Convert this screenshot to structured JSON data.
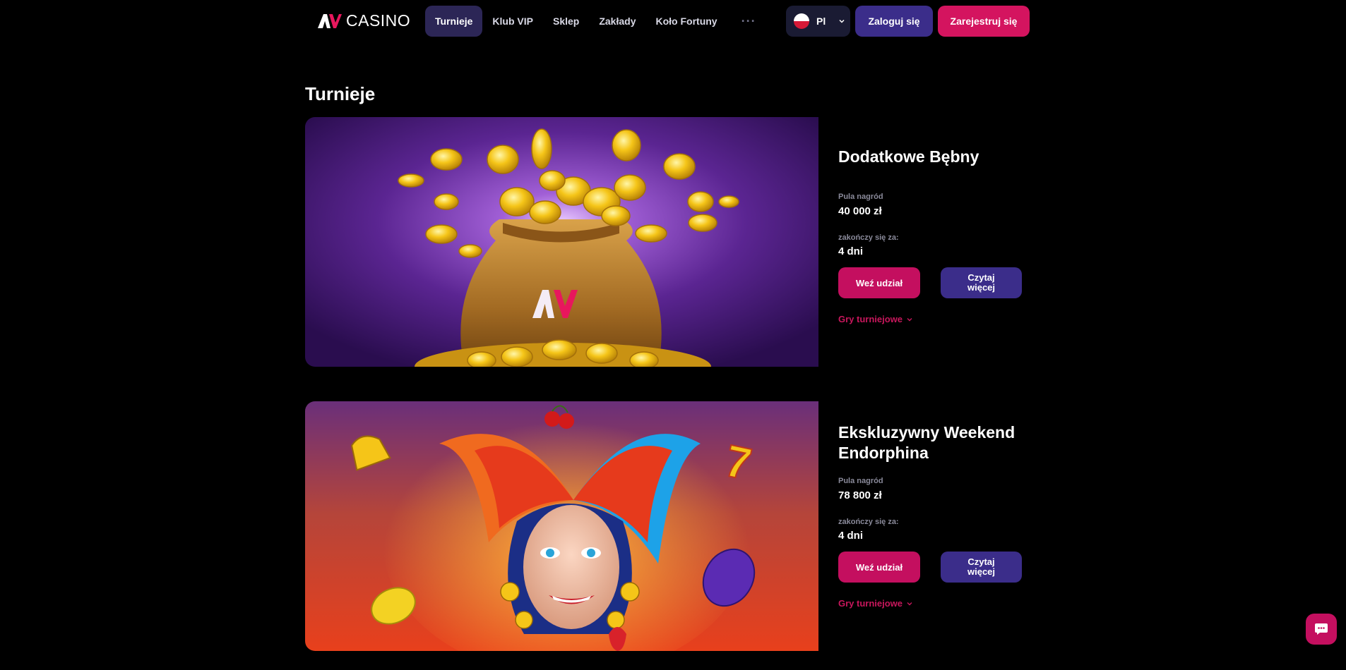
{
  "header": {
    "logo_text": "CASINO",
    "nav": [
      {
        "label": "Turnieje",
        "active": true
      },
      {
        "label": "Klub VIP"
      },
      {
        "label": "Sklep"
      },
      {
        "label": "Zakłady"
      },
      {
        "label": "Koło Fortuny"
      }
    ],
    "more_label": "···",
    "language": "Pl",
    "login_label": "Zaloguj się",
    "register_label": "Zarejestruj się"
  },
  "page": {
    "title": "Turnieje"
  },
  "tournaments": [
    {
      "title": "Dodatkowe Bębny",
      "prize_label": "Pula nagród",
      "prize_value": "40 000 zł",
      "ends_label": "zakończy się za:",
      "ends_value": "4 dni",
      "join_label": "Weź udział",
      "more_label": "Czytaj więcej",
      "games_label": "Gry turniejowe",
      "image": "gold-coin-sack"
    },
    {
      "title": "Ekskluzywny Weekend Endorphina",
      "prize_label": "Pula nagród",
      "prize_value": "78 800 zł",
      "ends_label": "zakończy się za:",
      "ends_value": "4 dni",
      "join_label": "Weź udział",
      "more_label": "Czytaj więcej",
      "games_label": "Gry turniejowe",
      "image": "jester-slot-symbols"
    }
  ],
  "colors": {
    "background": "#000000",
    "primary_purple": "#3b2d8a",
    "accent_pink": "#c40f5f",
    "nav_active": "#2c2656"
  },
  "chat": {
    "icon": "chat-icon"
  }
}
